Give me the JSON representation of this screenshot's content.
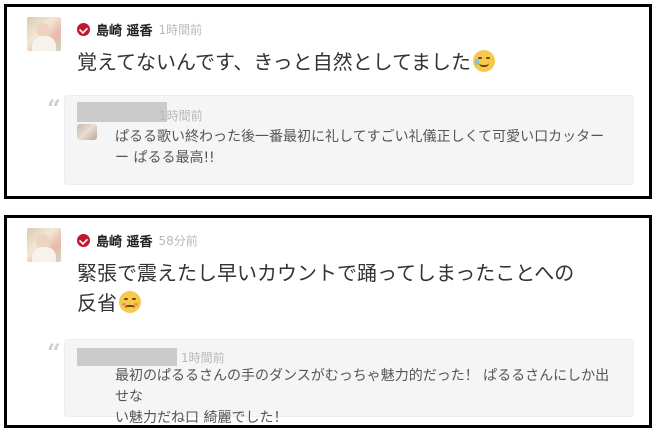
{
  "posts": [
    {
      "author": "島崎 遥香",
      "time": "1時間前",
      "message": "覚えてないんです、きっと自然としてました",
      "emoji": "face-with-tears-of-joy",
      "reply": {
        "time": "1時間前",
        "text_lines": [
          "ぱるる歌い終わった後一番最初に礼してすごい礼儀正しくて可愛い口カッター",
          "ー ぱるる最高!!"
        ]
      }
    },
    {
      "author": "島崎 遥香",
      "time": "58分前",
      "message_lines": [
        "緊張で震えたし早いカウントで踊ってしまったことへの",
        "反省"
      ],
      "emoji": "confounded-face",
      "reply": {
        "time": "1時間前",
        "text_lines": [
          "最初のぱるるさんの手のダンスがむっちゃ魅力的だった！ ぱるるさんにしか出せな",
          "い魅力だね口 綺麗でした！"
        ]
      }
    }
  ],
  "colors": {
    "verified": "#c4172f",
    "frame": "#000000",
    "reply_bg": "#f5f5f5",
    "muted": "#b8b8b8"
  }
}
